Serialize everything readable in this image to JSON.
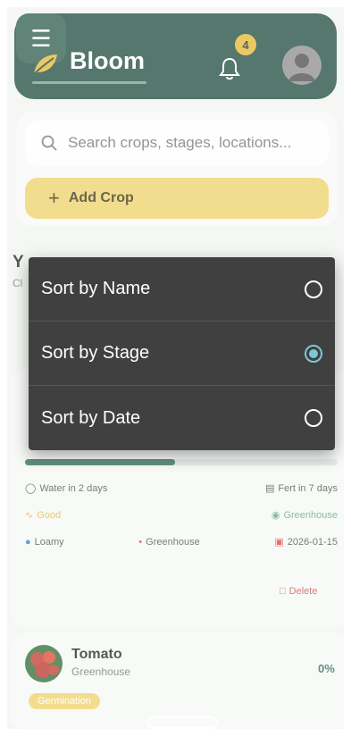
{
  "header": {
    "brand": "Bloom",
    "notification_count": "4",
    "menu_icon": "hamburger-icon",
    "bell_icon": "bell-icon",
    "avatar_icon": "user-avatar-icon",
    "colors": {
      "header_bg": "#1d4a3c",
      "badge": "#e6b632"
    }
  },
  "search": {
    "placeholder": "Search crops, stages, locations...",
    "icon": "search-icon"
  },
  "add_crop": {
    "plus": "+",
    "label": "Add Crop",
    "color": "#eed26a"
  },
  "section": {
    "title": "Y",
    "subtitle": "Cl"
  },
  "sort_menu": {
    "selected": "Sort by Stage",
    "options": [
      {
        "label": "Sort by Name",
        "checked": false
      },
      {
        "label": "Sort by Stage",
        "checked": true
      },
      {
        "label": "Sort by Date",
        "checked": false
      }
    ],
    "accent": "#7ec6d9"
  },
  "crop_card_1": {
    "progress": 0.48,
    "water": "Water in 2 days",
    "fert": "Fert in 7 days",
    "health": "Good",
    "location_tag": "Greenhouse",
    "soil": "Loamy",
    "location": "Greenhouse",
    "date": "2026-01-15",
    "delete_label": "Delete"
  },
  "crop_card_2": {
    "name": "Tomato",
    "location": "Greenhouse",
    "percent": "0%",
    "stage": "Germination"
  }
}
